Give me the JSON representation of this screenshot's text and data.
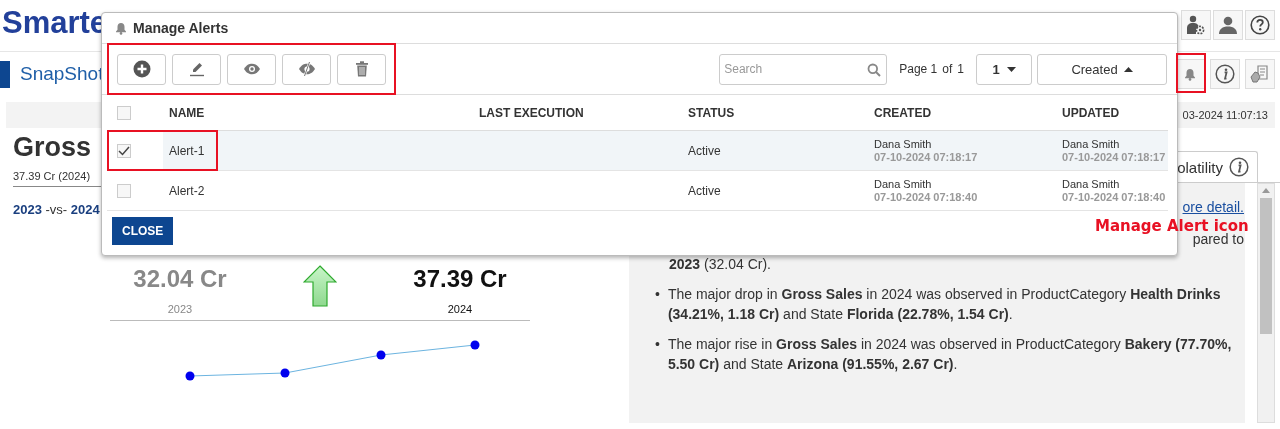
{
  "header": {
    "logo": "Smarte",
    "page_title": "SnapShot",
    "timestamp": "03-2024 11:07:13",
    "alerts_button_highlighted": true
  },
  "metric": {
    "title": "Gross",
    "subtitle": "37.39 Cr (2024)",
    "comparison": {
      "from": "2023",
      "separator": "-vs-",
      "to": "2024"
    },
    "previous": {
      "value": "32.04 Cr",
      "year": "2023"
    },
    "current": {
      "value": "37.39 Cr",
      "year": "2024"
    }
  },
  "insights": {
    "tab": "olatility",
    "link": "ore detail.",
    "fragment_end": "pared to",
    "fragment_tail": "**2023** (32.04 Cr).",
    "bullets": [
      {
        "marker": "•",
        "text": "The major drop in **Gross Sales** in 2024 was observed in ProductCategory **Health Drinks (34.21%, 1.18 Cr)** and State **Florida (22.78%, 1.54 Cr)**."
      },
      {
        "marker": "•",
        "text": "The major rise in **Gross Sales** in 2024 was observed in ProductCategory **Bakery (77.70%, 5.50 Cr)** and State **Arizona (91.55%, 2.67 Cr)**."
      }
    ]
  },
  "dialog": {
    "title": "Manage Alerts",
    "toolbar_highlighted": true,
    "toolbar": [
      {
        "kind": "add"
      },
      {
        "kind": "edit"
      },
      {
        "kind": "view"
      },
      {
        "kind": "hide"
      },
      {
        "kind": "delete"
      }
    ],
    "search": {
      "placeholder": "Search"
    },
    "pager": {
      "label": "Page",
      "page": "1",
      "of": "of",
      "total": "1"
    },
    "page_select": "1",
    "sort": {
      "label": "Created"
    },
    "header_checked": false,
    "columns": [
      "NAME",
      "LAST EXECUTION",
      "STATUS",
      "CREATED",
      "UPDATED"
    ],
    "rows": [
      {
        "checked": true,
        "highlighted": true,
        "name": "Alert-1",
        "status": "Active",
        "created_by": "Dana Smith",
        "created_at": "07-10-2024 07:18:17",
        "updated_by": "Dana Smith",
        "updated_at": "07-10-2024 07:18:17"
      },
      {
        "checked": false,
        "highlighted": false,
        "name": "Alert-2",
        "status": "Active",
        "created_by": "Dana Smith",
        "created_at": "07-10-2024 07:18:40",
        "updated_by": "Dana Smith",
        "updated_at": "07-10-2024 07:18:40"
      }
    ],
    "close": "CLOSE"
  },
  "callout": "Manage Alert icon"
}
